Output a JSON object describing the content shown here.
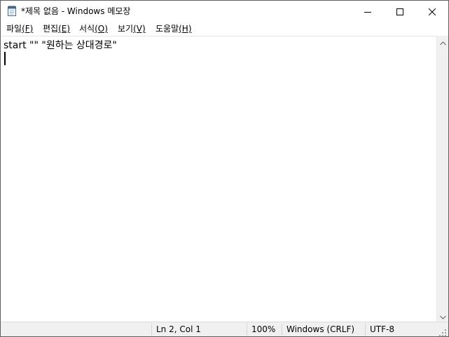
{
  "window": {
    "title": "*제목 없음 - Windows 메모장",
    "icon": "notepad-icon",
    "controls": {
      "minimize": "minimize-icon",
      "maximize": "maximize-icon",
      "close": "close-icon"
    }
  },
  "menu": {
    "items": [
      {
        "label": "파일",
        "accel": "(F)"
      },
      {
        "label": "편집",
        "accel": "(E)"
      },
      {
        "label": "서식",
        "accel": "(O)"
      },
      {
        "label": "보기",
        "accel": "(V)"
      },
      {
        "label": "도움말",
        "accel": "(H)"
      }
    ]
  },
  "editor": {
    "lines": [
      "start \"\" \"원하는 상대경로\"",
      ""
    ]
  },
  "status": {
    "position": "Ln 2, Col 1",
    "zoom": "100%",
    "line_ending": "Windows (CRLF)",
    "encoding": "UTF-8"
  },
  "colors": {
    "window_border": "#5f5f5f",
    "statusbar_bg": "#f0f0f0",
    "scrollbar_bg": "#f0f0f0"
  }
}
